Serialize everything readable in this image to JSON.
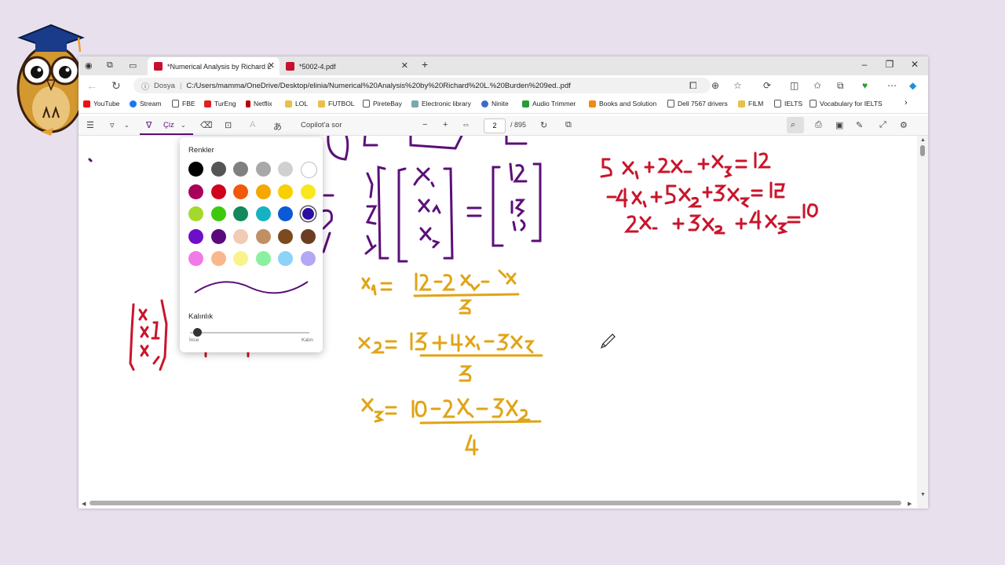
{
  "tabs": [
    {
      "label": "*Numerical Analysis by Richard L",
      "active": true
    },
    {
      "label": "*5002-4.pdf",
      "active": false
    }
  ],
  "address": {
    "security_label": "Dosya",
    "url": "C:/Users/mamma/OneDrive/Desktop/elinia/Numerical%20Analysis%20by%20Richard%20L.%20Burden%209ed..pdf"
  },
  "favorites": [
    "YouTube",
    "Stream",
    "FBE",
    "TurEng",
    "Netflix",
    "LOL",
    "FUTBOL",
    "PireteBay",
    "Electronic library",
    "Ninite",
    "Audio Trimmer",
    "Books and Solution",
    "Dell 7567 drivers",
    "FILM",
    "IELTS",
    "Vocabulary for IELTS"
  ],
  "pdf_toolbar": {
    "draw_label": "Çiz",
    "copilot_label": "Copilot'a sor",
    "page_current": "2",
    "page_total": "/ 895"
  },
  "draw_popup": {
    "colors_title": "Renkler",
    "colors": [
      "#000000",
      "#555555",
      "#808080",
      "#a8a8a8",
      "#d0d0d0",
      "#ffffff",
      "#a8005a",
      "#d0021b",
      "#f05a0a",
      "#f5a800",
      "#f8cf00",
      "#f8e71c",
      "#a3d92b",
      "#3ec90e",
      "#12895a",
      "#16b2c2",
      "#0a5ad6",
      "#2a0fa0",
      "#6d0fc9",
      "#5a0a7a",
      "#f2cbb4",
      "#c09065",
      "#7b4a1e",
      "#6b3e24",
      "#f27ae6",
      "#f8b88b",
      "#f8f48b",
      "#8bf0a0",
      "#8bd3f8",
      "#b4a8f5"
    ],
    "thickness_label": "Kalınlık",
    "thin_label": "İnce",
    "thick_label": "Kalın"
  },
  "colors": {
    "ink_purple": "#5b0f78",
    "ink_gold": "#e0a416",
    "ink_red": "#c9152b",
    "selected_color": "#2a0fa0"
  }
}
